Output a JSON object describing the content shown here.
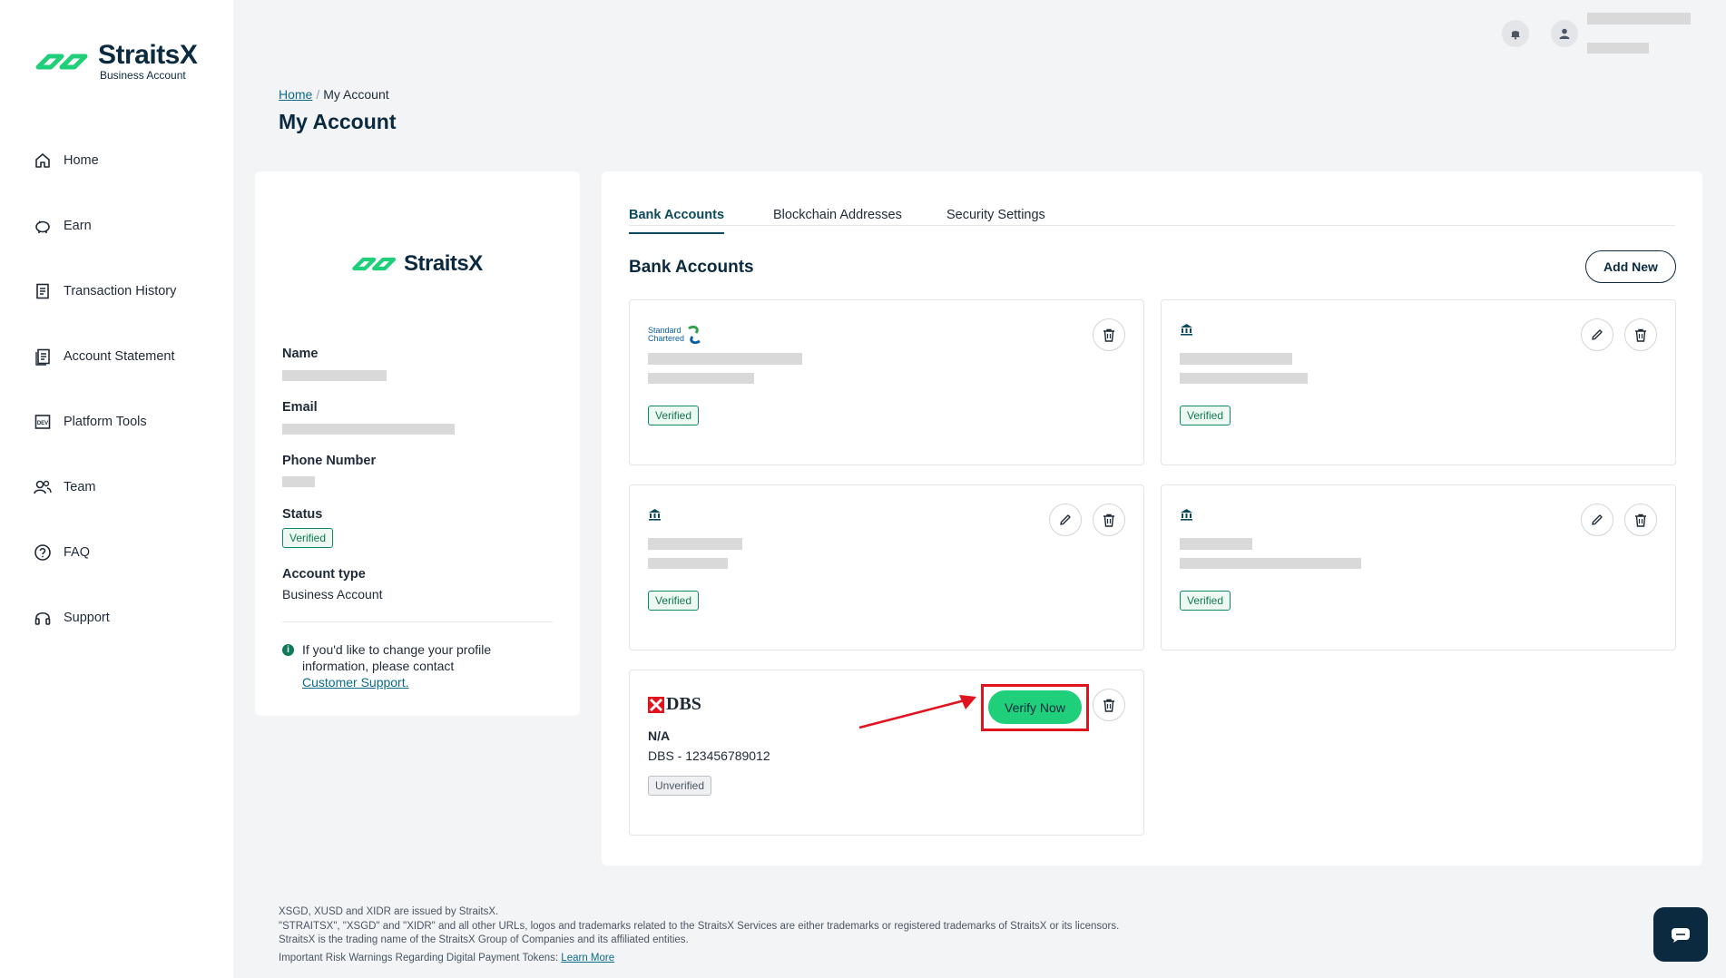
{
  "brand": {
    "name": "StraitsX",
    "subtitle": "Business Account",
    "accent": "#1fcf7a",
    "navy": "#0b2a3f"
  },
  "sidebar": {
    "items": [
      {
        "label": "Home",
        "icon": "home-icon"
      },
      {
        "label": "Earn",
        "icon": "piggy-bank-icon"
      },
      {
        "label": "Transaction History",
        "icon": "receipt-icon"
      },
      {
        "label": "Account Statement",
        "icon": "document-icon"
      },
      {
        "label": "Platform Tools",
        "icon": "dev-icon"
      },
      {
        "label": "Team",
        "icon": "team-icon"
      },
      {
        "label": "FAQ",
        "icon": "help-icon"
      },
      {
        "label": "Support",
        "icon": "headset-icon"
      }
    ]
  },
  "breadcrumb": {
    "home": "Home",
    "sep": "/",
    "current": "My Account"
  },
  "page": {
    "title": "My Account"
  },
  "profile": {
    "logo_text": "StraitsX",
    "name_label": "Name",
    "email_label": "Email",
    "phone_label": "Phone Number",
    "status_label": "Status",
    "status_value": "Verified",
    "account_type_label": "Account type",
    "account_type_value": "Business Account",
    "info_text": "If you'd like to change your profile information, please contact",
    "info_link": "Customer Support."
  },
  "tabs": [
    "Bank Accounts",
    "Blockchain Addresses",
    "Security Settings"
  ],
  "bank_accounts": {
    "title": "Bank Accounts",
    "add_label": "Add New",
    "cards": [
      {
        "bank": "Standard Chartered",
        "logo_line1": "Standard",
        "logo_line2": "Chartered",
        "status": "Verified"
      },
      {
        "bank": "Generic bank",
        "status": "Verified"
      },
      {
        "bank": "Generic bank",
        "status": "Verified"
      },
      {
        "bank": "Generic bank",
        "status": "Verified"
      },
      {
        "bank": "DBS",
        "logo_text": "DBS",
        "account_name": "N/A",
        "account_number": "DBS - 123456789012",
        "status": "Unverified",
        "verify_label": "Verify Now"
      }
    ]
  },
  "footer": {
    "line1": "XSGD, XUSD and XIDR are issued by StraitsX.",
    "line2": "\"STRAITSX\", \"XSGD\" and \"XIDR\" and all other URLs, logos and trademarks related to the StraitsX Services are either trademarks or registered trademarks of StraitsX or its licensors.",
    "line3": "StraitsX is the trading name of the StraitsX Group of Companies and its affiliated entities.",
    "line4": "Important Risk Warnings Regarding Digital Payment Tokens:",
    "learn_more": "Learn More"
  }
}
